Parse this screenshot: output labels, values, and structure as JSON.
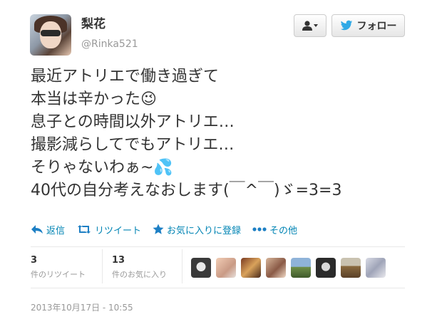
{
  "profile": {
    "name": "梨花",
    "handle": "@Rinka521"
  },
  "buttons": {
    "user_icon": "user-icon",
    "follow_label": "フォロー"
  },
  "tweet": {
    "lines": [
      "最近アトリエで働き過ぎて",
      "本当は辛かった😉",
      "息子との時間以外アトリエ…",
      "撮影減らしてでもアトリエ…",
      "そりゃないわぁ~💦",
      "40代の自分考えなおします(￣^￣)ゞ=3=3"
    ]
  },
  "actions": {
    "reply": "返信",
    "retweet": "リツイート",
    "favorite": "お気に入りに登録",
    "more": "その他"
  },
  "stats": {
    "retweets_count": "3",
    "retweets_label": "件のリツイート",
    "favorites_count": "13",
    "favorites_label": "件のお気に入り"
  },
  "timestamp": "2013年10月17日 - 10:55",
  "colors": {
    "link": "#0084b4",
    "twitter_blue": "#2fa9e6"
  }
}
